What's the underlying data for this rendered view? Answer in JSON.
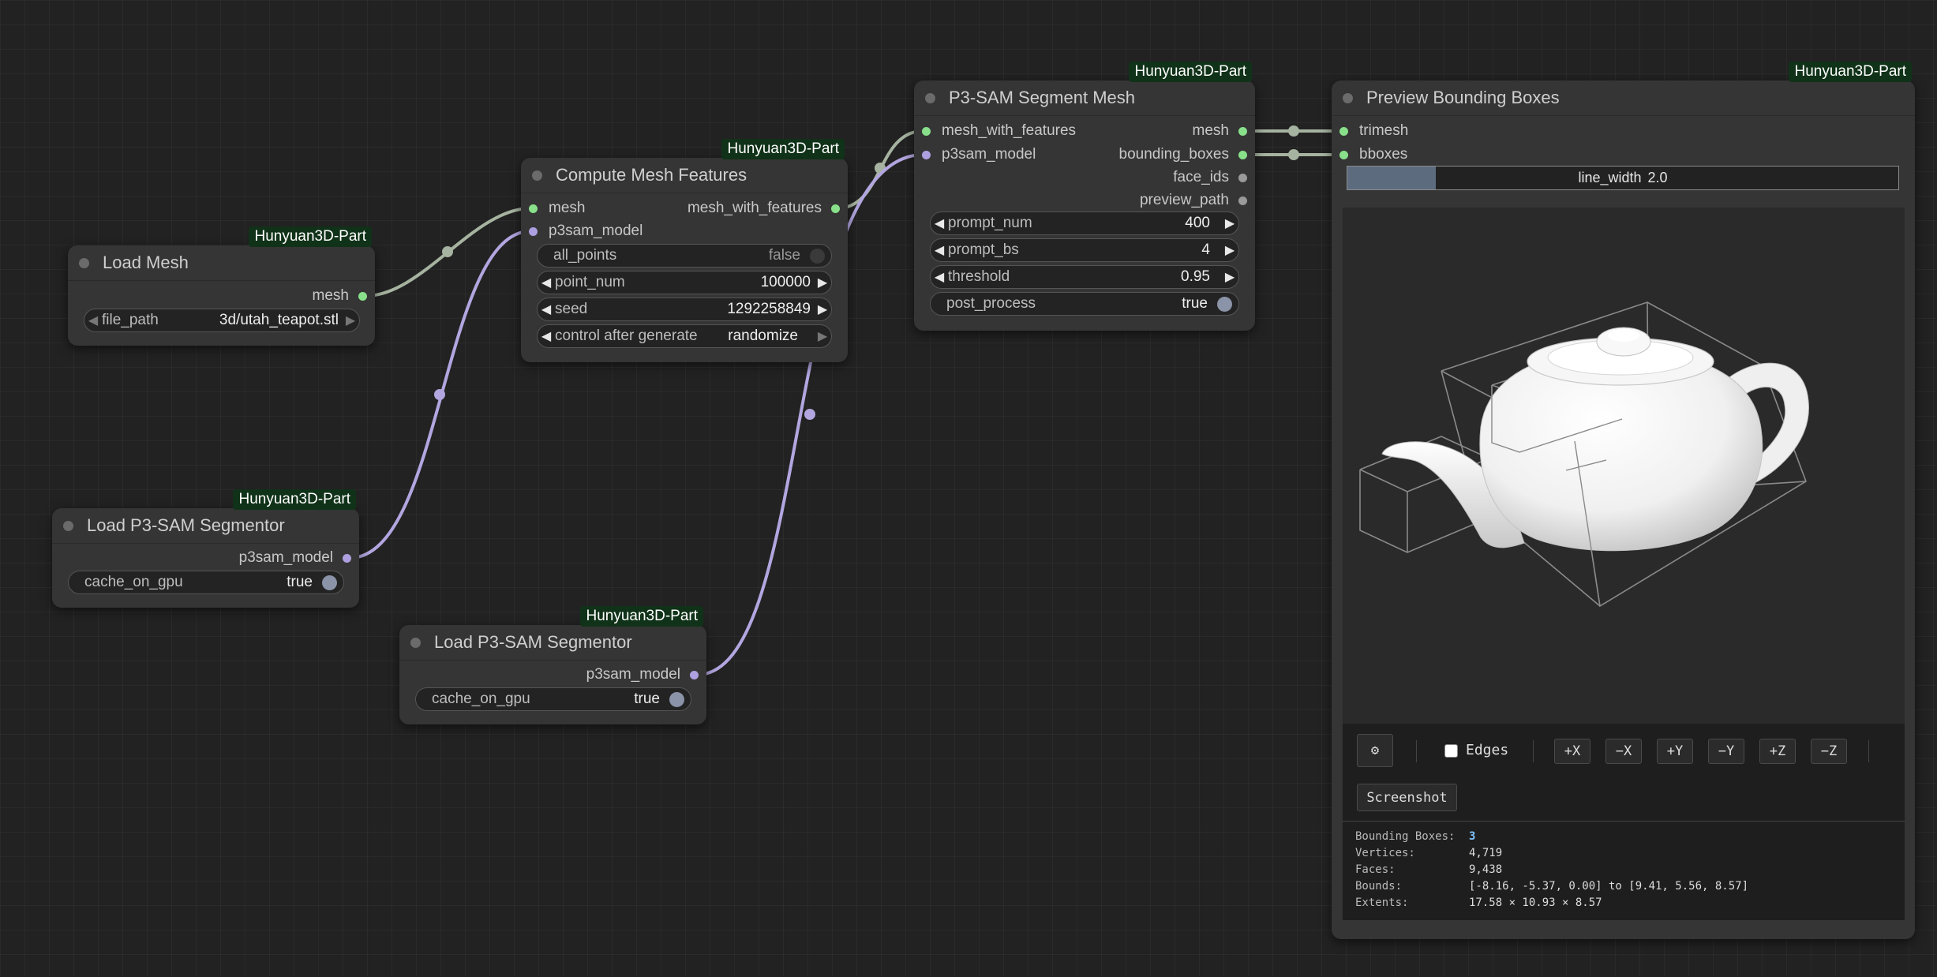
{
  "canvas": {
    "wire_colors": {
      "mesh": "#a6b3a0",
      "model": "#b3a6e0"
    }
  },
  "nodes": {
    "load_mesh": {
      "badge": "Hunyuan3D-Part",
      "title": "Load Mesh",
      "output": "mesh",
      "file_path": {
        "name": "file_path",
        "value": "3d/utah_teapot.stl"
      }
    },
    "compute_features": {
      "badge": "Hunyuan3D-Part",
      "title": "Compute Mesh Features",
      "inputs": [
        "mesh",
        "p3sam_model"
      ],
      "output": "mesh_with_features",
      "all_points": {
        "name": "all_points",
        "value": "false"
      },
      "point_num": {
        "name": "point_num",
        "value": "100000"
      },
      "seed": {
        "name": "seed",
        "value": "1292258849"
      },
      "control": {
        "name": "control after generate",
        "value": "randomize"
      }
    },
    "load_sam_1": {
      "badge": "Hunyuan3D-Part",
      "title": "Load P3-SAM Segmentor",
      "output": "p3sam_model",
      "cache": {
        "name": "cache_on_gpu",
        "value": "true"
      }
    },
    "load_sam_2": {
      "badge": "Hunyuan3D-Part",
      "title": "Load P3-SAM Segmentor",
      "output": "p3sam_model",
      "cache": {
        "name": "cache_on_gpu",
        "value": "true"
      }
    },
    "segment": {
      "badge": "Hunyuan3D-Part",
      "title": "P3-SAM Segment Mesh",
      "inputs": [
        "mesh_with_features",
        "p3sam_model"
      ],
      "outputs": [
        "mesh",
        "bounding_boxes",
        "face_ids",
        "preview_path"
      ],
      "prompt_num": {
        "name": "prompt_num",
        "value": "400"
      },
      "prompt_bs": {
        "name": "prompt_bs",
        "value": "4"
      },
      "threshold": {
        "name": "threshold",
        "value": "0.95"
      },
      "post_process": {
        "name": "post_process",
        "value": "true"
      }
    },
    "preview": {
      "badge": "Hunyuan3D-Part",
      "title": "Preview Bounding Boxes",
      "inputs": [
        "trimesh",
        "bboxes"
      ],
      "line_width": {
        "name": "line_width",
        "value": "2.0",
        "fraction": 0.16
      },
      "toolbar": {
        "settings_icon": "⚙",
        "edges_label": "Edges",
        "edges_checked": false,
        "axes": [
          "+X",
          "−X",
          "+Y",
          "−Y",
          "+Z",
          "−Z"
        ],
        "screenshot": "Screenshot"
      },
      "info": [
        {
          "label": "Bounding Boxes:",
          "value": "3"
        },
        {
          "label": "Vertices:",
          "value": "4,719"
        },
        {
          "label": "Faces:",
          "value": "9,438"
        },
        {
          "label": "Bounds:",
          "value": "[-8.16, -5.37, 0.00] to [9.41, 5.56, 8.57]"
        },
        {
          "label": "Extents:",
          "value": "17.58 × 10.93 × 8.57"
        }
      ]
    }
  }
}
